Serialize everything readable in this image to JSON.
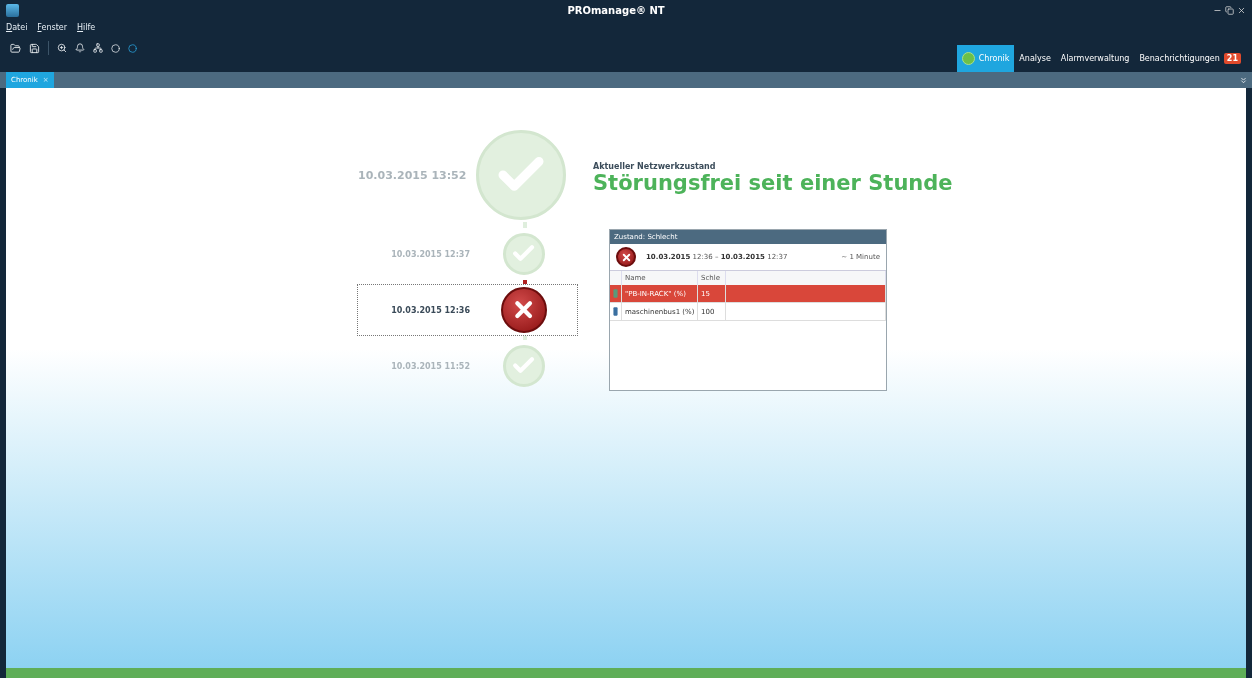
{
  "window": {
    "title": "PROmanage® NT"
  },
  "menu": [
    {
      "label": "Datei"
    },
    {
      "label": "Fenster"
    },
    {
      "label": "Hilfe"
    }
  ],
  "nav_tabs": [
    {
      "label": "Chronik",
      "selected": true
    },
    {
      "label": "Analyse",
      "selected": false
    },
    {
      "label": "Alarmverwaltung",
      "selected": false
    },
    {
      "label": "Benachrichtigungen",
      "selected": false,
      "badge": "21"
    }
  ],
  "doc_tabs": [
    {
      "label": "Chronik",
      "close": "×",
      "selected": true
    }
  ],
  "current_state": {
    "time": "10.03.2015 13:52",
    "kind": "ok",
    "selected": false,
    "caption": "Aktueller Netzwerkzustand",
    "headline": "Störungsfrei seit einer Stunde"
  },
  "timeline": [
    {
      "time": "10.03.2015 12:37",
      "kind": "ok",
      "selected": false
    },
    {
      "time": "10.03.2015 12:36",
      "kind": "error",
      "selected": true
    },
    {
      "time": "10.03.2015 11:52",
      "kind": "ok",
      "selected": false
    }
  ],
  "detail": {
    "title": "Zustand: Schlecht",
    "kind": "error",
    "range": "**10.03.2015** 12:36 – **10.03.2015** 12:37",
    "duration": "~ 1 Minute",
    "columns": [
      "Name",
      "Schle"
    ],
    "rows": [
      {
        "cells": [
          "\"PB-IN-RACK\" (%)",
          "15"
        ],
        "alarm": true
      },
      {
        "cells": [
          "maschinenbus1 (%)",
          "100"
        ],
        "alarm": false
      }
    ]
  }
}
